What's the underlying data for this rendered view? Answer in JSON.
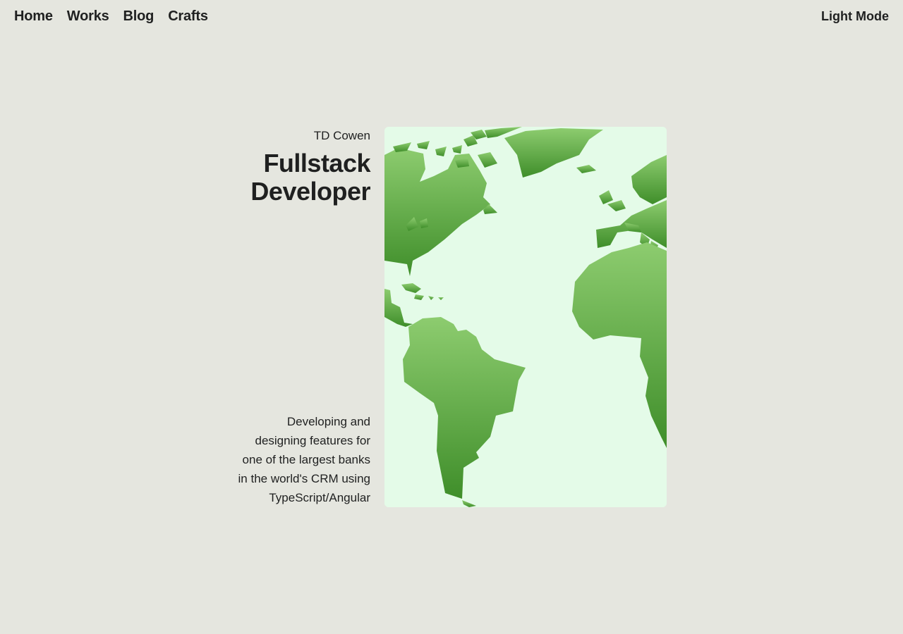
{
  "nav": {
    "items": [
      {
        "label": "Home"
      },
      {
        "label": "Works"
      },
      {
        "label": "Blog"
      },
      {
        "label": "Crafts"
      }
    ],
    "theme_toggle": "Light Mode"
  },
  "hero": {
    "author": "TD Cowen",
    "title_line1": "Fullstack",
    "title_line2": "Developer",
    "description": "Developing and designing features for one of the largest banks in the world's CRM using TypeScript/Angular"
  },
  "colors": {
    "background": "#e5e6df",
    "text": "#1f2020",
    "map_ocean": "#e4fbe8",
    "map_land_top": "#8dcc6f",
    "map_land_bottom": "#3f8e2a"
  },
  "icons": {
    "map": "world-map-atlantic-icon"
  }
}
